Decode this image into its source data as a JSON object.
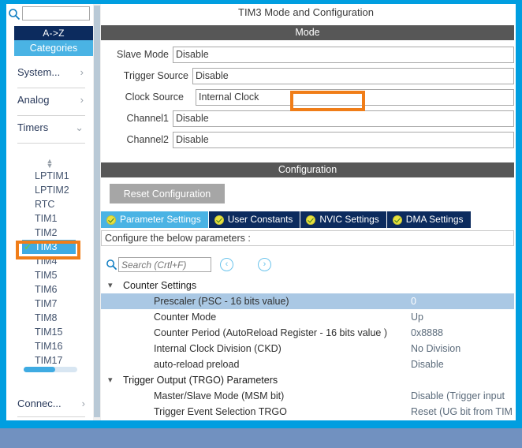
{
  "colors": {
    "frame_blue": "#009ee0",
    "accent_cyan": "#4ab3e4",
    "navy": "#0c2b5e",
    "annotation_orange": "#f07d18",
    "bar_dark": "#575757",
    "selected_row": "#aac8e4",
    "page_bg": "#7191c0"
  },
  "sidebar": {
    "search": {
      "value": "",
      "placeholder": ""
    },
    "search_icon": "search-icon",
    "toggle": {
      "az_label": "A->Z",
      "categories_label": "Categories"
    },
    "groups": [
      {
        "label": "System...",
        "arrow": "›"
      },
      {
        "label": "Analog",
        "arrow": "›"
      },
      {
        "label": "Timers",
        "arrow": "⌄"
      }
    ],
    "peripherals": [
      {
        "label": "LPTIM1",
        "selected": false,
        "checked": false
      },
      {
        "label": "LPTIM2",
        "selected": false,
        "checked": false
      },
      {
        "label": "RTC",
        "selected": false,
        "checked": false
      },
      {
        "label": "TIM1",
        "selected": false,
        "checked": false
      },
      {
        "label": "TIM2",
        "selected": false,
        "checked": false
      },
      {
        "label": "TIM3",
        "selected": true,
        "checked": true
      },
      {
        "label": "TIM4",
        "selected": false,
        "checked": false
      },
      {
        "label": "TIM5",
        "selected": false,
        "checked": false
      },
      {
        "label": "TIM6",
        "selected": false,
        "checked": false
      },
      {
        "label": "TIM7",
        "selected": false,
        "checked": false
      },
      {
        "label": "TIM8",
        "selected": false,
        "checked": false
      },
      {
        "label": "TIM15",
        "selected": false,
        "checked": false
      },
      {
        "label": "TIM16",
        "selected": false,
        "checked": false
      },
      {
        "label": "TIM17",
        "selected": false,
        "checked": false
      }
    ],
    "bottom_group": {
      "label": "Connec...",
      "arrow": "›"
    }
  },
  "header": {
    "title": "TIM3 Mode and Configuration"
  },
  "mode": {
    "section_title": "Mode",
    "fields": [
      {
        "label": "Slave Mode",
        "value": "Disable",
        "highlighted": false
      },
      {
        "label": "Trigger Source",
        "value": "Disable",
        "highlighted": false
      },
      {
        "label": "Clock Source",
        "value": "Internal Clock",
        "highlighted": true
      },
      {
        "label": "Channel1",
        "value": "Disable",
        "highlighted": false
      },
      {
        "label": "Channel2",
        "value": "Disable",
        "highlighted": false
      }
    ]
  },
  "configuration": {
    "section_title": "Configuration",
    "reset_button": "Reset Configuration",
    "tabs": [
      {
        "label": "Parameter Settings",
        "active": true
      },
      {
        "label": "User Constants",
        "active": false
      },
      {
        "label": "NVIC Settings",
        "active": false
      },
      {
        "label": "DMA Settings",
        "active": false
      }
    ],
    "configure_hint": "Configure the below parameters :",
    "param_search": {
      "value": "",
      "placeholder": "Search (Crtl+F)",
      "icon": "search-icon",
      "back_icon": "‹",
      "forward_icon": "›"
    },
    "tree": [
      {
        "group": "Counter Settings",
        "expanded": true,
        "rows": [
          {
            "name": "Prescaler (PSC - 16 bits value)",
            "value": "0",
            "selected": true
          },
          {
            "name": "Counter Mode",
            "value": "Up",
            "selected": false
          },
          {
            "name": "Counter Period (AutoReload Register - 16 bits value )",
            "value": "0x8888",
            "selected": false
          },
          {
            "name": "Internal Clock Division (CKD)",
            "value": "No Division",
            "selected": false
          },
          {
            "name": "auto-reload preload",
            "value": "Disable",
            "selected": false
          }
        ]
      },
      {
        "group": "Trigger Output (TRGO) Parameters",
        "expanded": true,
        "rows": [
          {
            "name": "Master/Slave Mode (MSM bit)",
            "value": "Disable (Trigger input ",
            "selected": false
          },
          {
            "name": "Trigger Event Selection TRGO",
            "value": "Reset (UG bit from TIM",
            "selected": false
          }
        ]
      }
    ]
  }
}
